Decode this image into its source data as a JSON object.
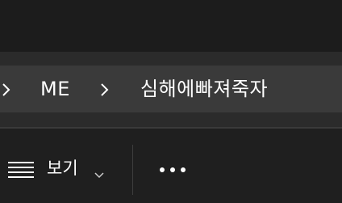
{
  "breadcrumb": {
    "items": [
      {
        "label": "ME"
      },
      {
        "label": "심해에빠져죽자"
      }
    ]
  },
  "toolbar": {
    "view_label": "보기"
  },
  "icons": {
    "breadcrumb_separator": "chevron-right-icon",
    "view": "lines-icon",
    "view_dropdown": "chevron-down-icon",
    "more": "more-dots-icon"
  },
  "colors": {
    "background": "#202020",
    "address_bar": "#3a3a3a",
    "text": "#ffffff"
  }
}
